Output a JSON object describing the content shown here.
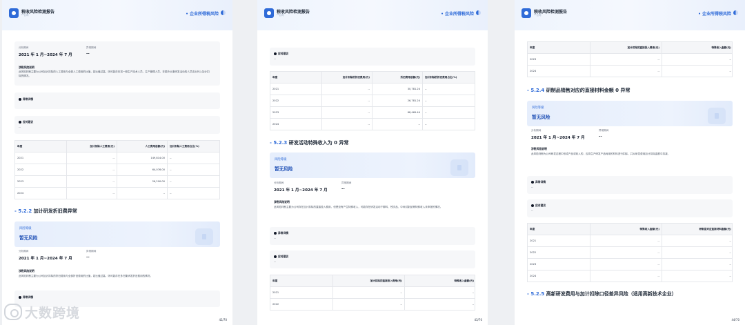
{
  "header": {
    "doc_title": "税收风险检测报告",
    "doc_sub": "**公司",
    "right_label": "企业所得税风险"
  },
  "common": {
    "analysis_period_label": "分析期间",
    "analysis_period": "2021 年 1 月~2024 年 7 月",
    "abnormal_period_label": "异常期间",
    "abnormal_period": "--",
    "risk_desc_heading": "涉税风险说明",
    "abnormal_detail": "异常详情",
    "response_advice": "应对建议",
    "dash": "--",
    "risk_level_label": "风险等级",
    "risk_level_value": "暂无风险"
  },
  "page1": {
    "risk_desc": "此风险判断主要为公司加计扣除的人工费用与全部人工费用的比值，若比值过高，则可能存在将一般生产技术人员、生产管理人员、非委外从事研发活动的人员支出列入加计扣除的情况。",
    "table": {
      "headers": [
        "年度",
        "加计扣除人工费用(元)",
        "人工费用总额(元)",
        "加计扣除人工费用占比(%)"
      ],
      "rows": [
        [
          "2021",
          "--",
          "149,814.00",
          "--"
        ],
        [
          "2022",
          "--",
          "64,076.00",
          "--"
        ],
        [
          "2023",
          "--",
          "26,290.00",
          "--"
        ],
        [
          "2024",
          "--",
          "--",
          "--"
        ]
      ]
    },
    "section_prefix": "- 5.2.2",
    "section_title": "加计研发折旧费异常",
    "risk_desc2": "此风险判断主要为公司加计扣除的折旧费用与全部折旧费用的比值，若比值过高，则可能存在多归集研发折旧费用的情况。",
    "page_number": "42/70"
  },
  "page2": {
    "table": {
      "headers": [
        "年度",
        "加计扣除的折旧费用(元)",
        "折旧费用总额(元)",
        "加计扣除的折旧费用占比(%)"
      ],
      "rows": [
        [
          "2021",
          "--",
          "30,781.24",
          "--"
        ],
        [
          "2022",
          "--",
          "26,781.24",
          "--"
        ],
        [
          "2023",
          "--",
          "68,469.44",
          "--"
        ],
        [
          "2024",
          "--",
          "--",
          "--"
        ]
      ]
    },
    "section_prefix": "- 5.2.3",
    "section_title": "研发活动特殊收入为 0 异常",
    "risk_desc": "此风险判断主要为公司存在加计扣除的直接投入费用，但是没有产生特殊收入，可能存在研发活动下脚料、残次品、中间试制品等特殊收入未申报的情况。",
    "table2": {
      "headers": [
        "年度",
        "加计扣除的直接投入费用(元)",
        "特殊收入金额(元)"
      ],
      "rows": [
        [
          "2021",
          "--",
          "--"
        ],
        [
          "2022",
          "--",
          "--"
        ]
      ]
    },
    "page_number": "43/70"
  },
  "page3": {
    "table": {
      "headers": [
        "年度",
        "加计扣除的直接投入费用(元)",
        "特殊收入金额(元)"
      ],
      "rows": [
        [
          "2023",
          "--",
          "--"
        ],
        [
          "2024",
          "--",
          "--"
        ]
      ]
    },
    "section_prefix": "- 5.2.4",
    "section_title": "研制品销售对应的直接材料金额 0 异常",
    "risk_desc": "此风险判断为公司研发过程中形成产品或收入的，应将生产研发产品耗用的材料进行扣除，并从研发费用加计扣除金额中扣减。",
    "table2": {
      "headers": [
        "年度",
        "特殊收入金额(元)",
        "研制品对应直接材料金额(元)"
      ],
      "rows": [
        [
          "2021",
          "--",
          "--"
        ],
        [
          "2022",
          "--",
          "--"
        ],
        [
          "2023",
          "--",
          "--"
        ],
        [
          "2024",
          "--",
          "--"
        ]
      ]
    },
    "section2_prefix": "- 5.2.5",
    "section2_title": "高新研发费用与加计扣除口径差异风险（适用高新技术企业）",
    "page_number": "44/70"
  },
  "watermark": "大数跨境"
}
